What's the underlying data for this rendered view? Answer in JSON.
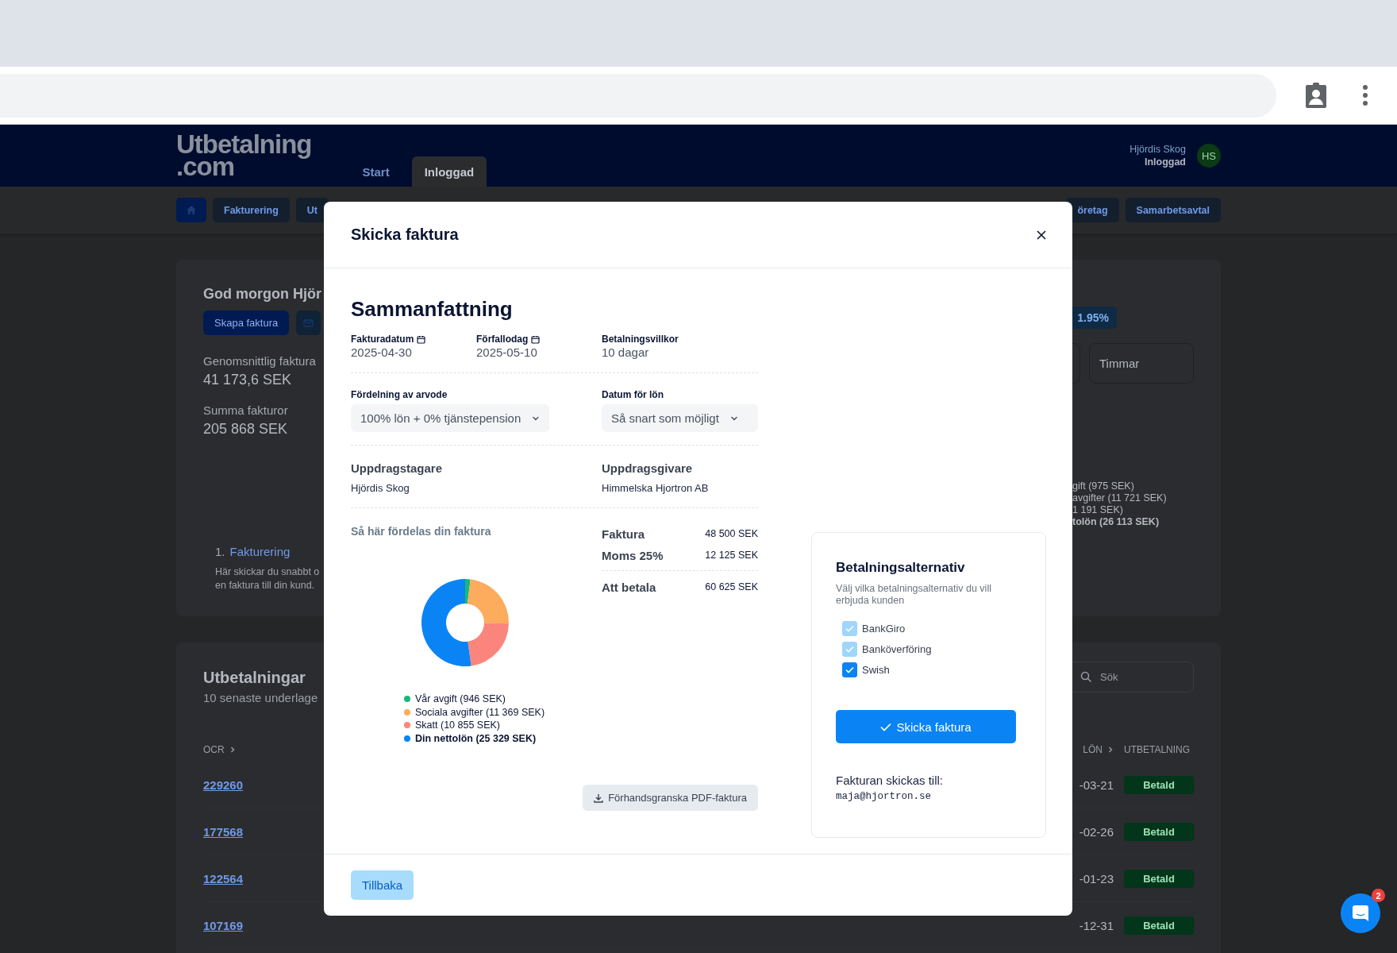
{
  "site": {
    "logo": {
      "line1": "Utbetalning",
      "line2": ".com"
    },
    "nav_tabs": [
      {
        "label": "Start",
        "selected": false
      },
      {
        "label": "Inloggad",
        "selected": true
      }
    ],
    "user": {
      "name": "Hjördis Skog",
      "status": "Inloggad",
      "initials": "HS"
    },
    "subnav_left": [
      "Fakturering",
      "Ut"
    ],
    "subnav_right": [
      "öretag",
      "Samarbetsavtal"
    ]
  },
  "overview": {
    "greeting": "God morgon Hjör",
    "create_button": "Skapa faktura",
    "stats": [
      {
        "label": "Genomsnittlig faktura",
        "value": "41 173,6 SEK"
      },
      {
        "label": "Summa fakturor",
        "value": "205 868 SEK"
      }
    ],
    "step": {
      "number": "1.",
      "title": "Fakturering",
      "lines": [
        "Här skickar du snabbt o",
        "en faktura till din kund."
      ]
    },
    "badge": "1.95%",
    "unit_box": "Timmar",
    "legend": [
      {
        "text": "gift (975 SEK)",
        "bold": false
      },
      {
        "text": "avgifter (11 721 SEK)",
        "bold": false
      },
      {
        "text": "1 191 SEK)",
        "bold": false
      },
      {
        "text": "tolön (26 113 SEK)",
        "bold": true
      }
    ]
  },
  "payouts": {
    "title": "Utbetalningar",
    "subtitle": "10 senaste underlage",
    "search": {
      "placeholder": "Sök"
    },
    "columns": [
      "OCR",
      "LÖN",
      "UTBETALNING"
    ],
    "rows": [
      {
        "ocr": "229260",
        "date": "-03-21",
        "status": "Betald"
      },
      {
        "ocr": "177568",
        "date": "-02-26",
        "status": "Betald"
      },
      {
        "ocr": "122564",
        "date": "-01-23",
        "status": "Betald"
      },
      {
        "ocr": "107169",
        "date": "-12-31",
        "status": "Betald"
      }
    ]
  },
  "modal": {
    "title": "Skicka faktura",
    "heading": "Sammanfattning",
    "facts": [
      {
        "label": "Fakturadatum",
        "value": "2025-04-30",
        "kind": "date"
      },
      {
        "label": "Förfallodag",
        "value": "2025-05-10",
        "kind": "date"
      },
      {
        "label": "Betalningsvillkor",
        "value": "10 dagar",
        "kind": "text"
      }
    ],
    "selects": [
      {
        "label": "Fördelning av arvode",
        "value": "100% lön + 0% tjänstepension"
      },
      {
        "label": "Datum för lön",
        "value": "Så snart som möjligt"
      }
    ],
    "parties": [
      {
        "label": "Uppdragstagare",
        "value": "Hjördis Skog"
      },
      {
        "label": "Uppdragsgivare",
        "value": "Himmelska Hjortron AB"
      }
    ],
    "distribution": {
      "title": "Så här fördelas din faktura",
      "chart_data": {
        "type": "donut",
        "categories": [
          "Vår avgift",
          "Sociala avgifter",
          "Skatt",
          "Din nettolön"
        ],
        "values": [
          1.95,
          23.44,
          22.38,
          52.23
        ]
      },
      "legend": [
        {
          "amount": "(946 SEK)",
          "color": "#17b978",
          "bold": false
        },
        {
          "amount": "(11 369 SEK)",
          "color": "#fdab5c",
          "bold": false
        },
        {
          "amount": "(10 855 SEK)",
          "color": "#fb857c",
          "bold": false
        },
        {
          "amount": "(25 329 SEK)",
          "color": "#0a84f5",
          "bold": true
        }
      ]
    },
    "totals": [
      {
        "label": "Faktura",
        "value": "48 500 SEK",
        "kind": "line"
      },
      {
        "label": "Moms 25%",
        "value": "12 125 SEK",
        "kind": "line"
      },
      {
        "label": "Att betala",
        "value": "60 625 SEK",
        "kind": "total"
      }
    ],
    "preview_button": "Förhandsgranska PDF-faktura",
    "payment": {
      "title": "Betalningsalternativ",
      "description": "Välj vilka betalningsalternativ du vill erbjuda kunden",
      "options": [
        {
          "label": "BankGiro",
          "checked": true,
          "disabled": true
        },
        {
          "label": "Banköverföring",
          "checked": true,
          "disabled": true
        },
        {
          "label": "Swish",
          "checked": true,
          "disabled": false
        }
      ],
      "send_button": "Skicka faktura",
      "recipient_label": "Fakturan skickas till:",
      "recipient_email": "maja@hjortron.se"
    },
    "back_button": "Tillbaka"
  },
  "chat": {
    "badge": "2"
  }
}
